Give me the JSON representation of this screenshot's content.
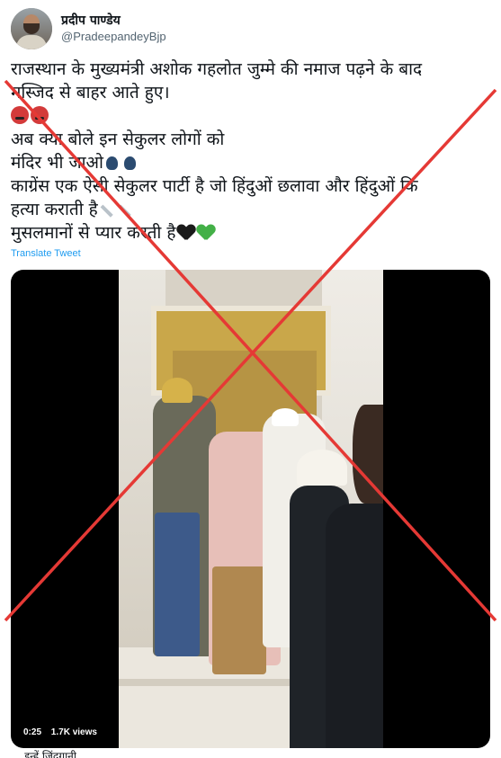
{
  "author": {
    "display_name": "प्रदीप पाण्डेय",
    "handle": "@PradeepandeyBjp"
  },
  "tweet": {
    "lines": [
      "राजस्थान के मुख्यमंत्री अशोक गहलोत जुम्मे की नमाज पढ़ने के बाद",
      "मस्जिद से बाहर आते हुए।",
      "अब क्या बोले इन सेकुलर लोगों को",
      "मंदिर भी जाओ",
      "काग्रेंस एक ऐसी सेकुलर पार्टी है जो हिंदुओं छलावा और हिंदुओं कि",
      "हत्या कराती है",
      "मुसलमानों से प्यार करती है"
    ],
    "emojis": {
      "angry": "enraged-face-icon",
      "speaking": "speaking-head-icon",
      "knife": "kitchen-knife-icon",
      "black_heart": "black-heart-icon",
      "green_heart": "green-heart-icon"
    },
    "translate_label": "Translate Tweet"
  },
  "video": {
    "duration": "0:25",
    "views": "1.7K views"
  },
  "bottom_snippet": "... इन्हें जिंदगानी",
  "colors": {
    "link_blue": "#1d9bf0",
    "cross_red": "#e53935",
    "black_heart": "#1a1a1a",
    "green_heart": "#43b047"
  }
}
